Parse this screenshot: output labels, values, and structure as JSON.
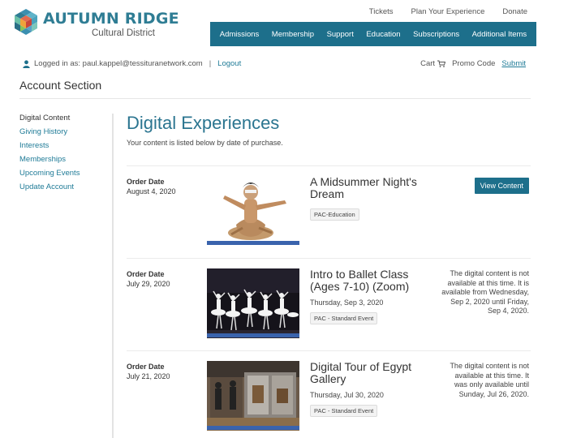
{
  "brand": {
    "name": "AUTUMN RIDGE",
    "tagline": "Cultural District",
    "colors": {
      "primary": "#1d6f8b",
      "link": "#1f7b97",
      "accent_bar": "#3a63ad"
    }
  },
  "utility_nav": [
    "Tickets",
    "Plan Your Experience",
    "Donate"
  ],
  "main_nav": [
    "Admissions",
    "Membership",
    "Support",
    "Education",
    "Subscriptions",
    "Additional Items"
  ],
  "login": {
    "icon": "user-icon",
    "text": "Logged in as: paul.kappel@tessituranetwork.com",
    "separator": "|",
    "logout": "Logout"
  },
  "cart": {
    "label": "Cart",
    "icon": "cart-icon",
    "promo_label": "Promo Code",
    "submit": "Submit"
  },
  "account": {
    "title": "Account Section",
    "sidebar": [
      "Digital Content",
      "Giving History",
      "Interests",
      "Memberships",
      "Upcoming Events",
      "Update Account"
    ]
  },
  "main": {
    "title": "Digital Experiences",
    "subtitle": "Your content is listed below by date of purchase.",
    "order_date_label": "Order Date",
    "orders": [
      {
        "date": "August 4, 2020",
        "title": "A Midsummer Night's Dream",
        "event_date": "",
        "tag": "PAC-Education",
        "button": "View Content",
        "status": ""
      },
      {
        "date": "July 29, 2020",
        "title": "Intro to Ballet Class (Ages 7-10) (Zoom)",
        "event_date": "Thursday, Sep 3, 2020",
        "tag": "PAC - Standard Event",
        "button": "",
        "status": "The digital content is not available at this time. It is available from Wednesday, Sep 2, 2020 until Friday, Sep 4, 2020."
      },
      {
        "date": "July 21, 2020",
        "title": "Digital Tour of Egypt Gallery",
        "event_date": "Thursday, Jul 30, 2020",
        "tag": "PAC - Standard Event",
        "button": "",
        "status": "The digital content is not available at this time. It was only available until Sunday, Jul 26, 2020."
      }
    ]
  }
}
